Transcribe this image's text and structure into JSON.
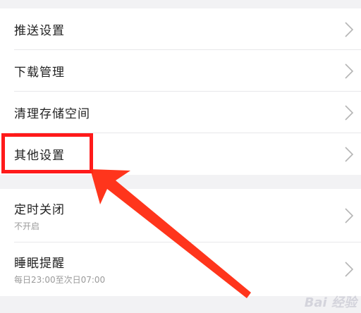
{
  "settings": {
    "group1": [
      {
        "label": "推送设置"
      },
      {
        "label": "下载管理"
      },
      {
        "label": "清理存储空间"
      },
      {
        "label": "其他设置"
      }
    ],
    "group2": [
      {
        "label": "定时关闭",
        "sub": "不开启"
      },
      {
        "label": "睡眠提醒",
        "sub": "每日23:00至次日07:00"
      }
    ]
  },
  "annotation": {
    "color": "#ff1a1a"
  },
  "watermark": "Bai 经验"
}
